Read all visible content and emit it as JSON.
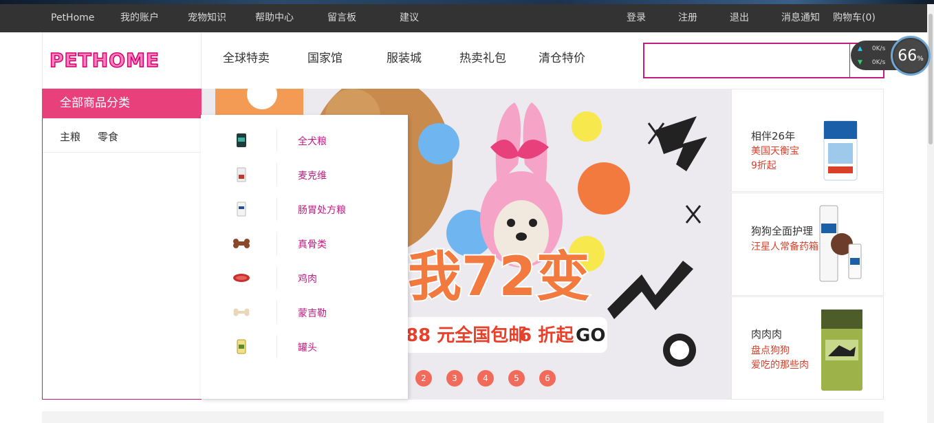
{
  "topbar": {
    "brand": "PetHome",
    "links": [
      "我的账户",
      "宠物知识",
      "帮助中心",
      "留言板",
      "建议"
    ],
    "right_links": [
      "登录",
      "注册",
      "退出",
      "消息通知",
      "购物车(0)"
    ]
  },
  "logo": {
    "text": "PETHOME"
  },
  "main_nav": [
    "全球特卖",
    "国家馆",
    "服装城",
    "热卖礼包",
    "清仓特价"
  ],
  "search": {
    "value": "",
    "placeholder": ""
  },
  "net_widget": {
    "upload": "0K/s",
    "download": "0K/s",
    "percent": "66",
    "percent_unit": "%"
  },
  "category": {
    "title": "全部商品分类",
    "tabs": [
      "主粮",
      "零食"
    ],
    "submenu": [
      {
        "label": "全犬粮",
        "icon": "dog-food-can-icon"
      },
      {
        "label": "麦克维",
        "icon": "food-bag-icon"
      },
      {
        "label": "肠胃处方粮",
        "icon": "prescription-bag-icon"
      },
      {
        "label": "真骨类",
        "icon": "bone-icon"
      },
      {
        "label": "鸡肉",
        "icon": "chicken-meat-icon"
      },
      {
        "label": "蒙吉勒",
        "icon": "chew-bone-icon"
      },
      {
        "label": "罐头",
        "icon": "canned-food-icon"
      }
    ]
  },
  "banner": {
    "headline": "我72变",
    "subline_1": "88 元全国包邮",
    "subline_2": "6 折起",
    "cta": "GO",
    "pagination": [
      "2",
      "3",
      "4",
      "5",
      "6"
    ]
  },
  "ads": [
    {
      "title": "相伴26年",
      "line1": "美国天衡宝",
      "line2": "9折起"
    },
    {
      "title": "狗狗全面护理",
      "line1": "汪星人常备药箱",
      "line2": ""
    },
    {
      "title": "肉肉肉",
      "line1": "盘点狗狗",
      "line2": "爱吃的那些肉"
    }
  ],
  "colors": {
    "accent": "#c21c83",
    "category_header": "#e8407b",
    "topbar": "#333333",
    "promo_red": "#d9402a"
  }
}
